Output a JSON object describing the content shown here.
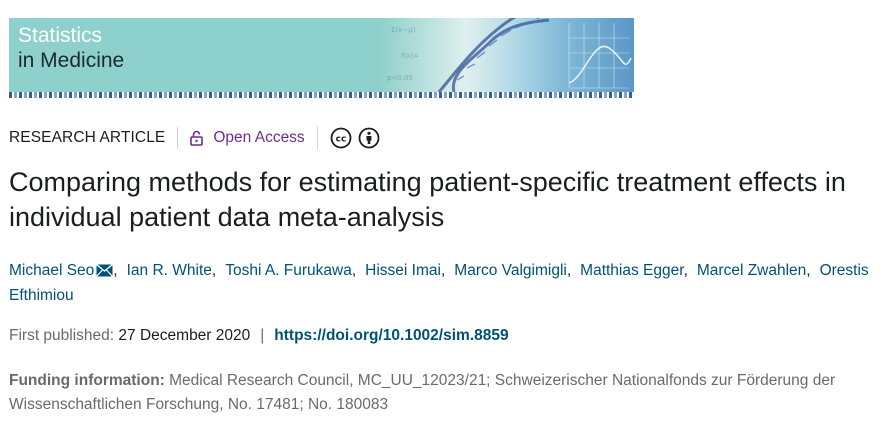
{
  "journal": {
    "name_line1": "Statistics",
    "name_line2": "in Medicine"
  },
  "meta": {
    "article_type": "RESEARCH ARTICLE",
    "open_access": "Open Access",
    "license_icons": [
      "cc-icon",
      "by-icon"
    ]
  },
  "article": {
    "title": "Comparing methods for estimating patient-specific treatment effects in individual patient data meta-analysis"
  },
  "authors": [
    "Michael Seo",
    "Ian R. White",
    "Toshi A. Furukawa",
    "Hissei Imai",
    "Marco Valgimigli",
    "Matthias Egger",
    "Marcel Zwahlen",
    "Orestis Efthimiou"
  ],
  "publication": {
    "label": "First published:",
    "date": "27 December 2020",
    "separator": "|",
    "doi": "https://doi.org/10.1002/sim.8859"
  },
  "funding": {
    "label": "Funding information:",
    "text": "Medical Research Council, MC_UU_12023/21; Schweizerischer Nationalfonds zur Förderung der Wissenschaftlichen Forschung, No. 17481; No. 180083"
  },
  "colors": {
    "link": "#005274",
    "open_access": "#6f2c91",
    "banner": "#8ed0cb"
  }
}
